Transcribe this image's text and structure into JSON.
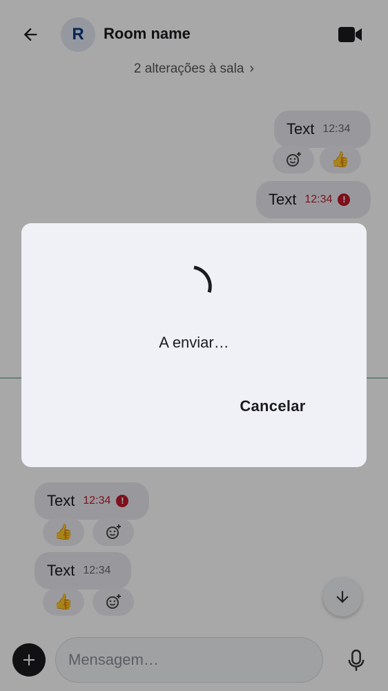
{
  "header": {
    "avatar_letter": "R",
    "room_name": "Room name",
    "back_icon": "arrow-left-icon",
    "video_icon": "video-camera-icon"
  },
  "timeline": {
    "room_changes": "2 alterações à sala",
    "messages": [
      {
        "text": "Text",
        "time": "12:34",
        "error": false,
        "side": "right"
      },
      {
        "text": "Text",
        "time": "12:34",
        "error": true,
        "side": "right"
      },
      {
        "text": "Text",
        "time": "12:34",
        "error": true,
        "side": "left"
      },
      {
        "text": "Text",
        "time": "12:34",
        "error": false,
        "side": "left"
      }
    ],
    "reaction_emoji": "👍",
    "add_reaction_icon": "add-reaction-icon"
  },
  "composer": {
    "placeholder": "Mensagem…"
  },
  "dialog": {
    "message": "A enviar…",
    "cancel_label": "Cancelar"
  },
  "colors": {
    "accent": "#1b1b1f",
    "error": "#c0182b",
    "avatar_bg": "#e3e7f1",
    "avatar_fg": "#0b3a82"
  }
}
